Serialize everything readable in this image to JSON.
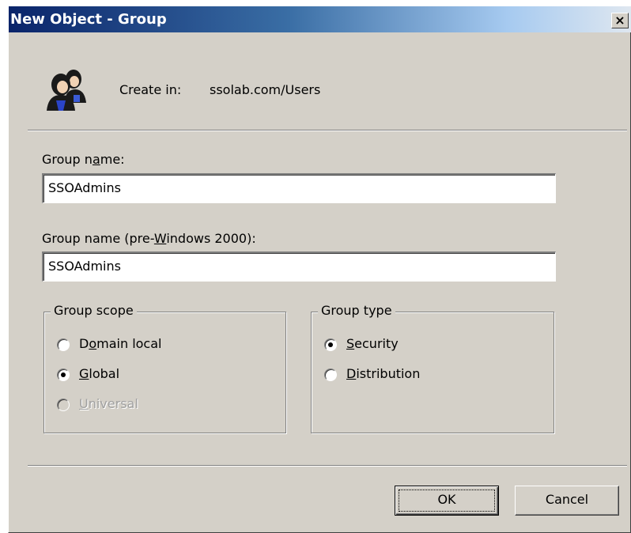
{
  "window": {
    "title": "New Object - Group",
    "close_glyph": "×"
  },
  "header": {
    "icon": "group-users-icon",
    "create_in_label": "Create in:",
    "create_in_value": "ssolab.com/Users"
  },
  "group_name": {
    "label_pre": "Group n",
    "label_u": "a",
    "label_post": "me:",
    "value": "SSOAdmins"
  },
  "group_name_pre2000": {
    "label_pre": "Group name (pre-",
    "label_u": "W",
    "label_post": "indows 2000):",
    "value": "SSOAdmins"
  },
  "group_scope": {
    "legend": "Group scope",
    "options": [
      {
        "pre": "D",
        "u": "o",
        "post": "main local",
        "checked": false,
        "disabled": false
      },
      {
        "pre": "",
        "u": "G",
        "post": "lobal",
        "checked": true,
        "disabled": false
      },
      {
        "pre": "",
        "u": "U",
        "post": "niversal",
        "checked": false,
        "disabled": true
      }
    ]
  },
  "group_type": {
    "legend": "Group type",
    "options": [
      {
        "pre": "",
        "u": "S",
        "post": "ecurity",
        "checked": true,
        "disabled": false
      },
      {
        "pre": "",
        "u": "D",
        "post": "istribution",
        "checked": false,
        "disabled": false
      }
    ]
  },
  "buttons": {
    "ok": "OK",
    "cancel": "Cancel"
  },
  "colors": {
    "title_bar_start": "#0a246a",
    "title_bar_end": "#a6caf0",
    "dialog_face": "#d4d0c8"
  }
}
